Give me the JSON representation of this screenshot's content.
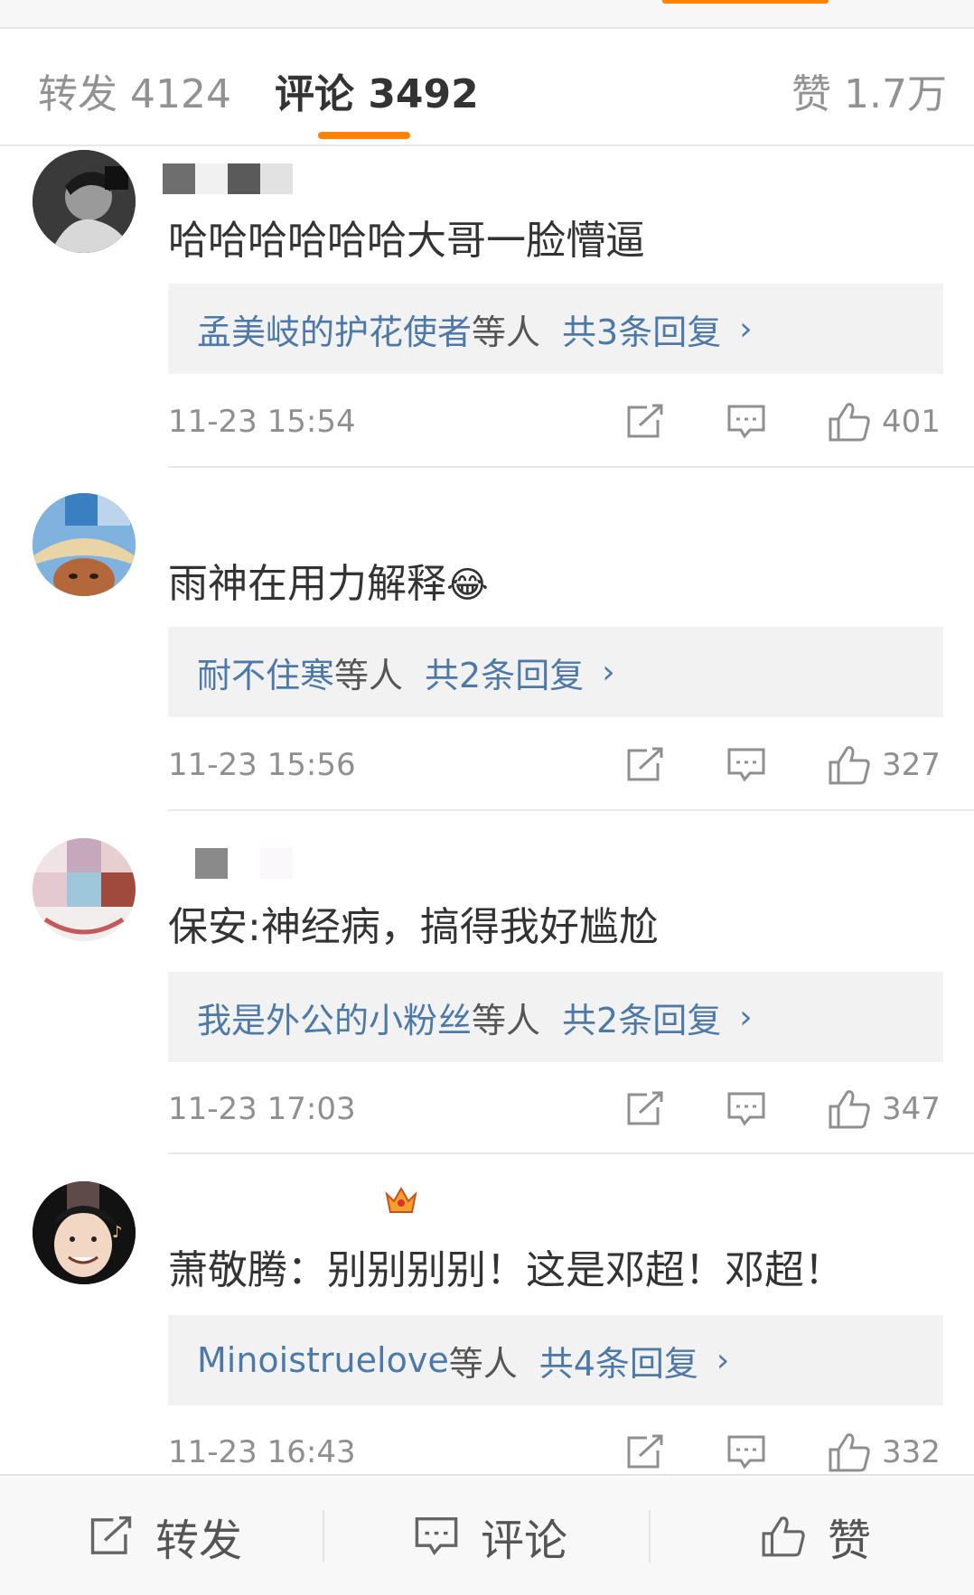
{
  "tabs": {
    "repost": "转发 4124",
    "comments": "评论 3492",
    "likes": "赞 1.7万"
  },
  "comments": [
    {
      "text": "哈哈哈哈哈哈大哥一脸懵逼",
      "reply_from": "孟美岐的护花使者",
      "reply_etc": "等人",
      "reply_count": "共3条回复",
      "time": "11-23 15:54",
      "likes": "401"
    },
    {
      "text": "雨神在用力解释",
      "emoji": "😂",
      "reply_from": "耐不住寒",
      "reply_etc": "等人",
      "reply_count": "共2条回复",
      "time": "11-23 15:56",
      "likes": "327"
    },
    {
      "text": "保安:神经病，搞得我好尴尬",
      "reply_from": "我是外公的小粉丝",
      "reply_etc": "等人",
      "reply_count": "共2条回复",
      "time": "11-23 17:03",
      "likes": "347"
    },
    {
      "text": "萧敬腾：别别别别！这是邓超！邓超！",
      "reply_from": "Minoistruelove",
      "reply_etc": "等人",
      "reply_count": "共4条回复",
      "time": "11-23 16:43",
      "likes": "332"
    }
  ],
  "chevron": "›",
  "bottom_bar": {
    "repost": "转发",
    "comment": "评论",
    "like": "赞"
  },
  "colors": {
    "accent": "#ff8200",
    "link": "#4d79a8",
    "muted": "#8f8f8f"
  }
}
